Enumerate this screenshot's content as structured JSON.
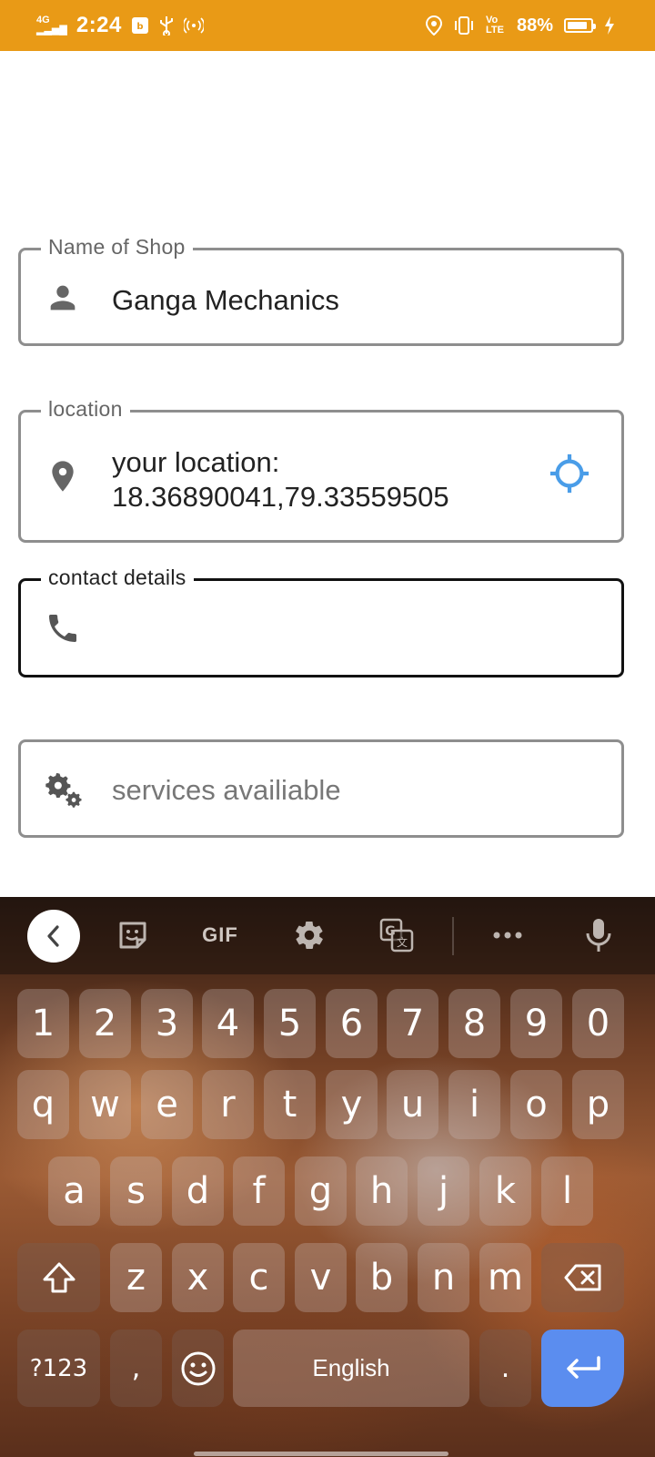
{
  "status_bar": {
    "network": "4G",
    "time": "2:24",
    "volte": "Vo LTE",
    "battery": "88%",
    "battery_level": 0.88,
    "background_color": "#E99A16"
  },
  "form": {
    "shop_name": {
      "label": "Name of Shop",
      "value": "Ganga Mechanics",
      "icon": "person-icon"
    },
    "location": {
      "label": "location",
      "line1": "your location:",
      "line2": "18.36890041,79.33559505",
      "icon": "location-pin-icon",
      "action_icon": "my-location-crosshair-icon",
      "action_color": "#4a9de8"
    },
    "contact": {
      "label": "contact details",
      "value": "",
      "icon": "phone-icon",
      "focused": true
    },
    "services": {
      "placeholder": "services availiable",
      "icon": "settings-gears-icon"
    }
  },
  "keyboard": {
    "toolbar": {
      "back": "chevron-left-icon",
      "sticker": "sticker-icon",
      "gif": "GIF",
      "settings": "gear-icon",
      "translate": "translate-icon",
      "more": "more-horizontal-icon",
      "mic": "microphone-icon"
    },
    "rows": {
      "numbers": [
        "1",
        "2",
        "3",
        "4",
        "5",
        "6",
        "7",
        "8",
        "9",
        "0"
      ],
      "row1": [
        "q",
        "w",
        "e",
        "r",
        "t",
        "y",
        "u",
        "i",
        "o",
        "p"
      ],
      "row2": [
        "a",
        "s",
        "d",
        "f",
        "g",
        "h",
        "j",
        "k",
        "l"
      ],
      "row3": [
        "z",
        "x",
        "c",
        "v",
        "b",
        "n",
        "m"
      ]
    },
    "symbols_key": "?123",
    "comma": ",",
    "space_label": "English",
    "period": ".",
    "shift": "shift-icon",
    "backspace": "backspace-icon",
    "emoji": "emoji-icon",
    "enter": "enter-icon",
    "enter_color": "#5b8def"
  }
}
